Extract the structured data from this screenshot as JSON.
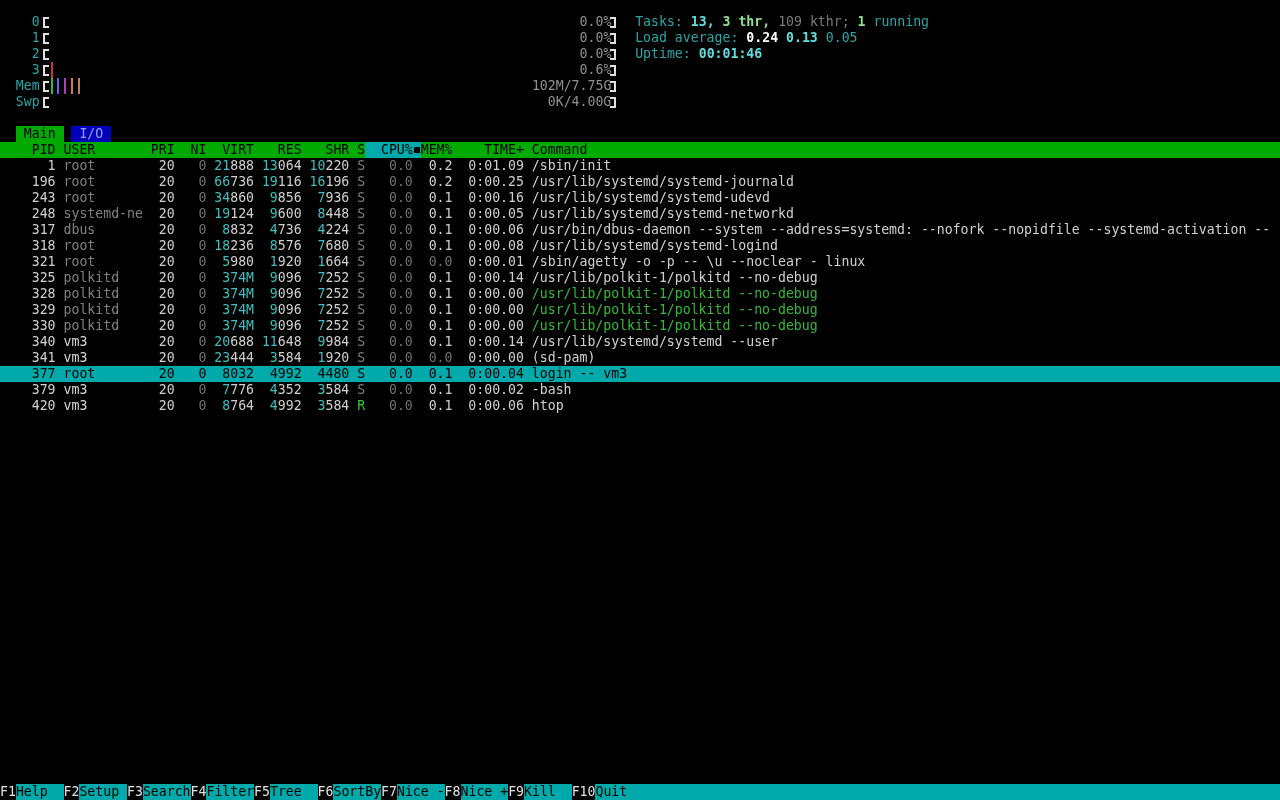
{
  "meters": [
    {
      "label": "0",
      "value": "0.0%"
    },
    {
      "label": "1",
      "value": "0.0%"
    },
    {
      "label": "2",
      "value": "0.0%"
    },
    {
      "label": "3",
      "value": "0.6%",
      "segments": [
        {
          "color": "#cc3333",
          "level": 0.014
        }
      ]
    },
    {
      "label": "Mem",
      "value": "102M/7.75G",
      "segments": [
        {
          "color": "#33bb33",
          "level": 0.014
        },
        {
          "color": "#6a5cf0",
          "level": 0.014
        },
        {
          "color": "#b040b0",
          "level": 0.014
        },
        {
          "color": "#d07a40",
          "level": 0.014
        },
        {
          "color": "#c08050",
          "level": 0.014
        }
      ]
    },
    {
      "label": "Swp",
      "value": "0K/4.00G"
    }
  ],
  "summary": [
    [
      {
        "text": "Tasks:",
        "kind": "label"
      },
      {
        "text": "13,",
        "kind": "value"
      },
      {
        "text": "3 thr,",
        "kind": "green"
      },
      {
        "text": "109 kthr;",
        "kind": "dim"
      },
      {
        "text": "1",
        "kind": "green"
      },
      {
        "text": "running",
        "kind": "label"
      }
    ],
    [
      {
        "text": "Load average:",
        "kind": "label"
      },
      {
        "text": "0.24",
        "kind": "white"
      },
      {
        "text": "0.13",
        "kind": "value"
      },
      {
        "text": "0.05",
        "kind": "label"
      }
    ],
    [
      {
        "text": "Uptime:",
        "kind": "label"
      },
      {
        "text": "00:01:46",
        "kind": "value"
      }
    ]
  ],
  "tabs": [
    {
      "label": "Main",
      "selected": true
    },
    {
      "label": "I/O",
      "selected": false
    }
  ],
  "columns": [
    {
      "label": "PID",
      "sorted": false
    },
    {
      "label": "USER",
      "sorted": false
    },
    {
      "label": "PRI",
      "sorted": false
    },
    {
      "label": "NI",
      "sorted": false
    },
    {
      "label": "VIRT",
      "sorted": false
    },
    {
      "label": "RES",
      "sorted": false
    },
    {
      "label": "SHR",
      "sorted": false
    },
    {
      "label": "S",
      "sorted": false
    },
    {
      "label": "CPU%",
      "sorted": true
    },
    {
      "label": "MEM%",
      "sorted": false
    },
    {
      "label": "TIME+",
      "sorted": false
    },
    {
      "label": "Command",
      "sorted": false
    }
  ],
  "processes": [
    {
      "cells": [
        "1",
        "root",
        "20",
        "0",
        "21888",
        "13064",
        "10220",
        "S",
        "0.0",
        "0.2",
        "0:01.09",
        "/sbin/init"
      ],
      "selected": false,
      "own_user": false,
      "running": false,
      "thread": false
    },
    {
      "cells": [
        "196",
        "root",
        "20",
        "0",
        "66736",
        "19116",
        "16196",
        "S",
        "0.0",
        "0.2",
        "0:00.25",
        "/usr/lib/systemd/systemd-journald"
      ],
      "selected": false,
      "own_user": false,
      "running": false,
      "thread": false
    },
    {
      "cells": [
        "243",
        "root",
        "20",
        "0",
        "34860",
        "9856",
        "7936",
        "S",
        "0.0",
        "0.1",
        "0:00.16",
        "/usr/lib/systemd/systemd-udevd"
      ],
      "selected": false,
      "own_user": false,
      "running": false,
      "thread": false
    },
    {
      "cells": [
        "248",
        "systemd-ne",
        "20",
        "0",
        "19124",
        "9600",
        "8448",
        "S",
        "0.0",
        "0.1",
        "0:00.05",
        "/usr/lib/systemd/systemd-networkd"
      ],
      "selected": false,
      "own_user": false,
      "running": false,
      "thread": false
    },
    {
      "cells": [
        "317",
        "dbus",
        "20",
        "0",
        "8832",
        "4736",
        "4224",
        "S",
        "0.0",
        "0.1",
        "0:00.06",
        "/usr/bin/dbus-daemon --system --address=systemd: --nofork --nopidfile --systemd-activation --"
      ],
      "selected": false,
      "own_user": false,
      "running": false,
      "thread": false
    },
    {
      "cells": [
        "318",
        "root",
        "20",
        "0",
        "18236",
        "8576",
        "7680",
        "S",
        "0.0",
        "0.1",
        "0:00.08",
        "/usr/lib/systemd/systemd-logind"
      ],
      "selected": false,
      "own_user": false,
      "running": false,
      "thread": false
    },
    {
      "cells": [
        "321",
        "root",
        "20",
        "0",
        "5980",
        "1920",
        "1664",
        "S",
        "0.0",
        "0.0",
        "0:00.01",
        "/sbin/agetty -o -p -- \\u --noclear - linux"
      ],
      "selected": false,
      "own_user": false,
      "running": false,
      "thread": false
    },
    {
      "cells": [
        "325",
        "polkitd",
        "20",
        "0",
        "374M",
        "9096",
        "7252",
        "S",
        "0.0",
        "0.1",
        "0:00.14",
        "/usr/lib/polkit-1/polkitd --no-debug"
      ],
      "selected": false,
      "own_user": false,
      "running": false,
      "thread": false
    },
    {
      "cells": [
        "328",
        "polkitd",
        "20",
        "0",
        "374M",
        "9096",
        "7252",
        "S",
        "0.0",
        "0.1",
        "0:00.00",
        "/usr/lib/polkit-1/polkitd --no-debug"
      ],
      "selected": false,
      "own_user": false,
      "running": false,
      "thread": true
    },
    {
      "cells": [
        "329",
        "polkitd",
        "20",
        "0",
        "374M",
        "9096",
        "7252",
        "S",
        "0.0",
        "0.1",
        "0:00.00",
        "/usr/lib/polkit-1/polkitd --no-debug"
      ],
      "selected": false,
      "own_user": false,
      "running": false,
      "thread": true
    },
    {
      "cells": [
        "330",
        "polkitd",
        "20",
        "0",
        "374M",
        "9096",
        "7252",
        "S",
        "0.0",
        "0.1",
        "0:00.00",
        "/usr/lib/polkit-1/polkitd --no-debug"
      ],
      "selected": false,
      "own_user": false,
      "running": false,
      "thread": true
    },
    {
      "cells": [
        "340",
        "vm3",
        "20",
        "0",
        "20688",
        "11648",
        "9984",
        "S",
        "0.0",
        "0.1",
        "0:00.14",
        "/usr/lib/systemd/systemd --user"
      ],
      "selected": false,
      "own_user": true,
      "running": false,
      "thread": false
    },
    {
      "cells": [
        "341",
        "vm3",
        "20",
        "0",
        "23444",
        "3584",
        "1920",
        "S",
        "0.0",
        "0.0",
        "0:00.00",
        "(sd-pam)"
      ],
      "selected": false,
      "own_user": true,
      "running": false,
      "thread": false
    },
    {
      "cells": [
        "377",
        "root",
        "20",
        "0",
        "8032",
        "4992",
        "4480",
        "S",
        "0.0",
        "0.1",
        "0:00.04",
        "login -- vm3"
      ],
      "selected": true
    },
    {
      "cells": [
        "379",
        "vm3",
        "20",
        "0",
        "7776",
        "4352",
        "3584",
        "S",
        "0.0",
        "0.1",
        "0:00.02",
        "-bash"
      ],
      "selected": false,
      "own_user": true,
      "running": false,
      "thread": false
    },
    {
      "cells": [
        "420",
        "vm3",
        "20",
        "0",
        "8764",
        "4992",
        "3584",
        "R",
        "0.0",
        "0.1",
        "0:00.06",
        "htop"
      ],
      "selected": false,
      "own_user": true,
      "running": true,
      "thread": false
    }
  ],
  "function_keys": [
    {
      "key": "F1",
      "label": "Help"
    },
    {
      "key": "F2",
      "label": "Setup"
    },
    {
      "key": "F3",
      "label": "Search"
    },
    {
      "key": "F4",
      "label": "Filter"
    },
    {
      "key": "F5",
      "label": "Tree"
    },
    {
      "key": "F6",
      "label": "SortBy"
    },
    {
      "key": "F7",
      "label": "Nice -"
    },
    {
      "key": "F8",
      "label": "Nice +"
    },
    {
      "key": "F9",
      "label": "Kill"
    },
    {
      "key": "F10",
      "label": "Quit"
    }
  ]
}
